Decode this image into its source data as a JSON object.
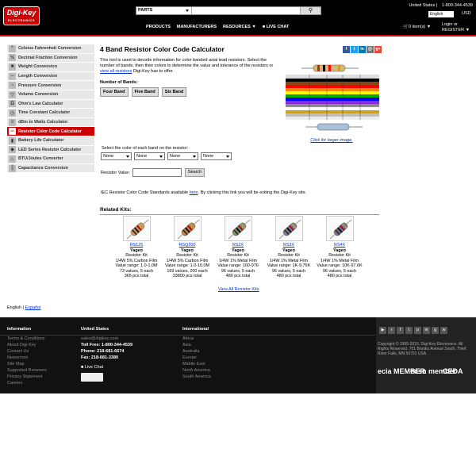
{
  "header": {
    "logo_text": "Digi-Key",
    "logo_sub": "ELECTRONICS",
    "search_category": "PARTS",
    "search_placeholder": "",
    "country": "United States",
    "phone": "1-800-344-4539",
    "language": "English",
    "currency": "USD",
    "nav": [
      "PRODUCTS",
      "MANUFACTURERS",
      "RESOURCES",
      "LIVE CHAT"
    ],
    "cart": "0 item(s)",
    "login": "Login or",
    "register": "REGISTER"
  },
  "sidebar": {
    "items": [
      {
        "label": "Celsius Fahrenheit Conversion",
        "icon": "thermometer-icon"
      },
      {
        "label": "Decimal Fraction Conversion",
        "icon": "fraction-icon"
      },
      {
        "label": "Weight Conversion",
        "icon": "weight-icon"
      },
      {
        "label": "Length Conversion",
        "icon": "ruler-icon"
      },
      {
        "label": "Pressure Conversion",
        "icon": "gauge-icon"
      },
      {
        "label": "Volume Conversion",
        "icon": "beaker-icon"
      },
      {
        "label": "Ohm's Law Calculator",
        "icon": "omega-icon"
      },
      {
        "label": "Time Constant Calculator",
        "icon": "clock-icon"
      },
      {
        "label": "dBm to Watts Calculator",
        "icon": "signal-icon"
      },
      {
        "label": "Resistor Color Code Calculator",
        "icon": "resistor-icon",
        "active": true
      },
      {
        "label": "Battery Life Calculator",
        "icon": "battery-icon"
      },
      {
        "label": "LED Series Resistor Calculator",
        "icon": "led-icon"
      },
      {
        "label": "BTU/Joules Converter",
        "icon": "flame-icon"
      },
      {
        "label": "Capacitance Conversion",
        "icon": "capacitor-icon"
      }
    ]
  },
  "main": {
    "title": "4 Band Resistor Color Code Calculator",
    "desc_1": "This tool is used to decode information for color banded axial lead resistors. Select the number of bands, then their colors to determine the value and tolerance of the resistors or ",
    "desc_link": "view all resistors",
    "desc_2": " Digi-Key has to offer.",
    "num_bands_label": "Number of Bands:",
    "band_buttons": [
      "Four Band",
      "Five Band",
      "Six Band"
    ],
    "chart_link": "Click for larger image.",
    "select_caption": "Select the color of each band on the resistor:",
    "band_selects": [
      "None",
      "None",
      "None",
      "None"
    ],
    "resistor_value_label": "Resistor Value:",
    "search_button": "Search",
    "iec_1": "IEC Resistor Color Code Standards available ",
    "iec_link": "here",
    "iec_2": ". By clicking this link you will be exiting the Digi-Key site.",
    "related_kits_label": "Related Kits:",
    "kits": [
      {
        "part": "RS125",
        "brand": "Yageo",
        "type": "Resistor Kit",
        "spec": "1/4W 5% Carbon Film",
        "range": "Value range: 1.0-1.0M",
        "count": "73 values, 5 each",
        "total": "365 pcs total",
        "body": "#c9a16a"
      },
      {
        "part": "RSQ200",
        "brand": "Yageo",
        "type": "Resistor Kit",
        "spec": "1/4W 5% Carbon Film",
        "range": "Value range: 1.0-10.0M",
        "count": "169 values, 200 each",
        "total": "33800 pcs total",
        "body": "#b88a55"
      },
      {
        "part": "RS2X",
        "brand": "Yageo",
        "type": "Resistor Kit",
        "spec": "1/4W 1% Metal Film",
        "range": "Value range: 100-976",
        "count": "96 values, 5 each",
        "total": "480 pcs total",
        "body": "#6f9a86"
      },
      {
        "part": "RS3X",
        "brand": "Yageo",
        "type": "Resistor Kit",
        "spec": "1/4W 1% Metal Film",
        "range": "Value range: 1K-9.76K",
        "count": "96 values, 5 each",
        "total": "480 pcs total",
        "body": "#6b86a8"
      },
      {
        "part": "RS4X",
        "brand": "Yageo",
        "type": "Resistor Kit",
        "spec": "1/4W 1% Metal Film",
        "range": "Value range: 10K-97.6K",
        "count": "96 values, 5 each",
        "total": "480 pcs total",
        "body": "#6979a3"
      }
    ],
    "view_all_kits": "View All Resistor Kits"
  },
  "languages": [
    "English",
    "Español"
  ],
  "footer": {
    "info_heading": "Information",
    "info_links": [
      "Terms & Conditions",
      "About Digi-Key",
      "Contact Us",
      "Newsroom",
      "Site Map",
      "Supported Browsers",
      "Privacy Statement",
      "Careers"
    ],
    "us_heading": "United States",
    "email": "sales@digikey.com",
    "tollfree": "Toll Free: 1-800-344-4539",
    "phone": "Phone: 218-681-6674",
    "fax": "Fax: 218-681-3380",
    "live_chat": "Live Chat",
    "intl_heading": "International",
    "intl_links": [
      "Africa",
      "Asia",
      "Australia",
      "Europe",
      "Middle East",
      "North America",
      "South America"
    ],
    "copyright": "Copyright © 1995-2015, Digi-Key Electronics. All Rights Reserved. 701 Brooks Avenue South, Thief River Falls, MN 56701 USA",
    "logos": [
      "ecia MEMBER",
      "ecsn member",
      "CEDA"
    ]
  }
}
